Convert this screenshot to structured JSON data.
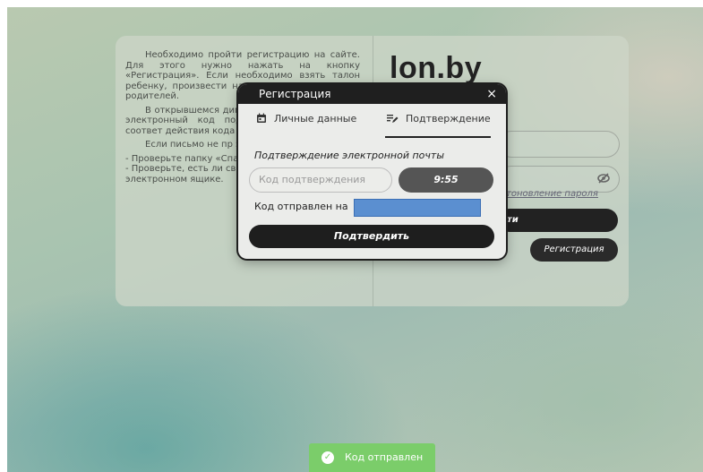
{
  "info": {
    "p1": "Необходимо пройти регистрацию на сайте. Для этого нужно нажать на кнопку «Регистрация». Если необходимо взять талон ребенку, произвести на электронную почту из родителей.",
    "p2": "В открывшемся димые данные. регистрации электронный код подтверждения, ввести в соответ действия кода 10 мину",
    "p3": "Если письмо не пр электронную почту:",
    "line1": "- Проверьте папку «Спам».",
    "line2": "- Проверьте, есть ли свободное место в электронном ящике."
  },
  "login": {
    "logo": "lon.by",
    "restore": "тоновление пароля",
    "login_btn": "ти",
    "register_btn": "Регистрация",
    "eye_icon": "eye-off-icon"
  },
  "modal": {
    "title": "Регистрация",
    "close": "×",
    "tab_personal": "Личные данные",
    "tab_confirm": "Подтверждение",
    "section_title": "Подтверждение электронной почты",
    "code_placeholder": "Код подтверждения",
    "timer": "9:55",
    "sent_label": "Код отправлен на",
    "confirm_btn": "Подтвердить"
  },
  "toast": {
    "text": "Код отправлен"
  },
  "colors": {
    "toast": "#7bcd6a",
    "modal_header": "#1f1f1f",
    "mask": "#5b8fd0"
  }
}
